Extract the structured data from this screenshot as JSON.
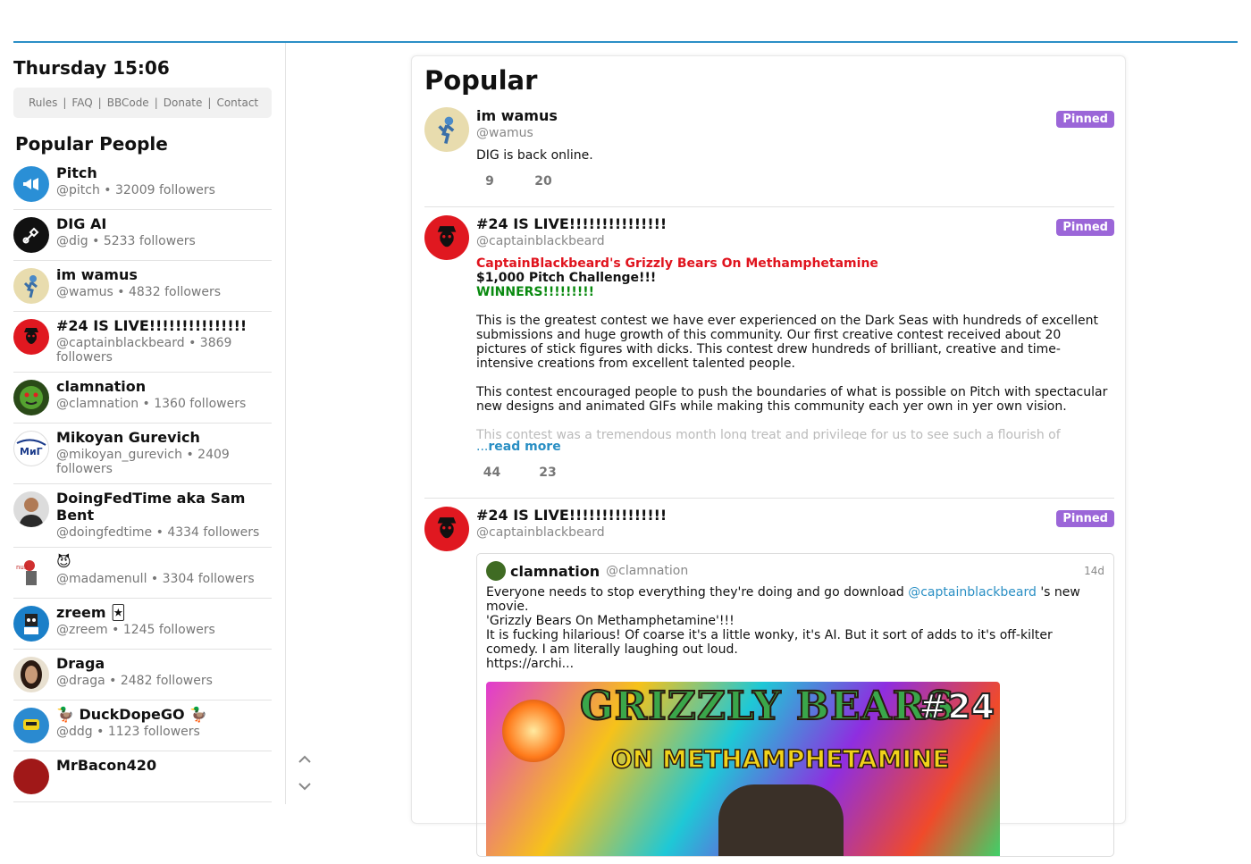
{
  "clock": "Thursday 15:06",
  "links": [
    "Rules",
    "FAQ",
    "BBCode",
    "Donate",
    "Contact"
  ],
  "popular_people_title": "Popular People",
  "people": [
    {
      "name": "Pitch",
      "meta": "@pitch • 32009 followers",
      "icon": "megaphone-icon"
    },
    {
      "name": "DIG AI",
      "meta": "@dig • 5233 followers",
      "icon": "shovel-icon"
    },
    {
      "name": "im wamus",
      "meta": "@wamus • 4832 followers",
      "icon": "avatar"
    },
    {
      "name": "#24 IS LIVE!!!!!!!!!!!!!!!",
      "meta": "@captainblackbeard • 3869 followers",
      "icon": "avatar"
    },
    {
      "name": "clamnation",
      "meta": "@clamnation • 1360 followers",
      "icon": "avatar"
    },
    {
      "name": "Mikoyan Gurevich",
      "meta": "@mikoyan_gurevich • 2409 followers",
      "icon": "avatar"
    },
    {
      "name": "DoingFedTime aka Sam Bent",
      "meta": "@doingfedtime • 4334 followers",
      "icon": "avatar"
    },
    {
      "name": "😈",
      "meta": "@madamenull • 3304 followers",
      "icon": "avatar"
    },
    {
      "name": "zreem 🃏",
      "meta": "@zreem • 1245 followers",
      "icon": "avatar"
    },
    {
      "name": "Draga",
      "meta": "@draga • 2482 followers",
      "icon": "avatar"
    },
    {
      "name": "🦆 DuckDopeGO 🦆",
      "meta": "@ddg • 1123 followers",
      "icon": "avatar"
    },
    {
      "name": "MrBacon420",
      "meta": "",
      "icon": "avatar"
    }
  ],
  "main": {
    "title": "Popular",
    "posts": [
      {
        "name": "im wamus",
        "handle": "@wamus",
        "badge": "Pinned",
        "text": "DIG is back online.",
        "likes": "9",
        "comments": "20"
      },
      {
        "name": "#24 IS LIVE!!!!!!!!!!!!!!!",
        "handle": "@captainblackbeard",
        "badge": "Pinned",
        "line_red": "CaptainBlackbeard's Grizzly Bears On Methamphetamine",
        "line_bold": "$1,000 Pitch Challenge!!!",
        "line_green": "WINNERS!!!!!!!!!",
        "para1": "This is the greatest contest we have ever experienced on the Dark Seas with hundreds of excellent submissions and huge growth of this community. Our first creative contest received about 20 pictures of stick figures with dicks. This contest drew hundreds of brilliant, creative and time-intensive creations from excellent talented people.",
        "para2": "This contest encouraged people to push the boundaries of what is possible on Pitch with spectacular new designs and animated GIFs while making this community each yer own in yer own vision.",
        "para3": "This contest was a tremendous month long treat and privilege for us to see such a flourish of",
        "read_more_prefix": "...",
        "read_more": "read more",
        "likes": "44",
        "comments": "23"
      },
      {
        "name": "#24 IS LIVE!!!!!!!!!!!!!!!",
        "handle": "@captainblackbeard",
        "badge": "Pinned",
        "quote": {
          "name": "clamnation",
          "handle": "@clamnation",
          "time": "14d",
          "text_pre": "Everyone needs to stop everything they're doing and go download ",
          "mention": "@captainblackbeard",
          "text_post": " 's new movie.",
          "line2": "'Grizzly Bears On Methamphetamine'!!!",
          "line3": "It is fucking hilarious! Of coarse it's a little wonky, it's AI. But it sort of adds to it's off-kilter comedy. I am literally laughing out loud.",
          "line4": "https://archi...",
          "poster_title": "GRIZZLY BEARS",
          "poster_subtitle": "ON METHAMPHETAMINE",
          "poster_number": "#24"
        }
      }
    ]
  },
  "colors": {
    "accent": "#2b8fc6",
    "pinned": "#9b66d8",
    "red": "#e0141e",
    "green": "#0a8a10"
  }
}
